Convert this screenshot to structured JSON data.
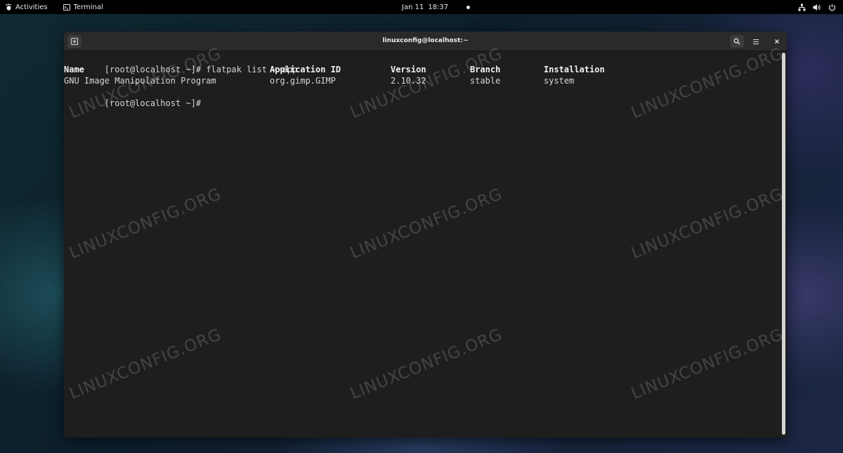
{
  "top_bar": {
    "activities": "Activities",
    "app_name": "Terminal",
    "date": "Jan 11",
    "time": "18:37"
  },
  "window": {
    "title": "linuxconfig@localhost:~"
  },
  "terminal": {
    "prompt": "[root@localhost ~]#",
    "command": "flatpak list --app",
    "headers": [
      "Name",
      "Application ID",
      "Version",
      "Branch",
      "Installation"
    ],
    "rows": [
      [
        "GNU Image Manipulation Program",
        "org.gimp.GIMP",
        "2.10.32",
        "stable",
        "system"
      ]
    ]
  },
  "watermark": "LINUXCONFIG.ORG",
  "icons": {
    "activities": "gnome-foot-icon",
    "app": "terminal-icon",
    "network": "network-icon",
    "volume": "volume-icon",
    "power": "power-icon",
    "new_tab": "new-tab-icon",
    "search": "search-icon",
    "menu": "hamburger-menu-icon",
    "close": "close-icon"
  },
  "colors": {
    "terminal_bg": "#1e1e1e",
    "header_bg": "#2a2a2a",
    "top_bar_bg": "#000000",
    "text": "#d6d6d6"
  }
}
